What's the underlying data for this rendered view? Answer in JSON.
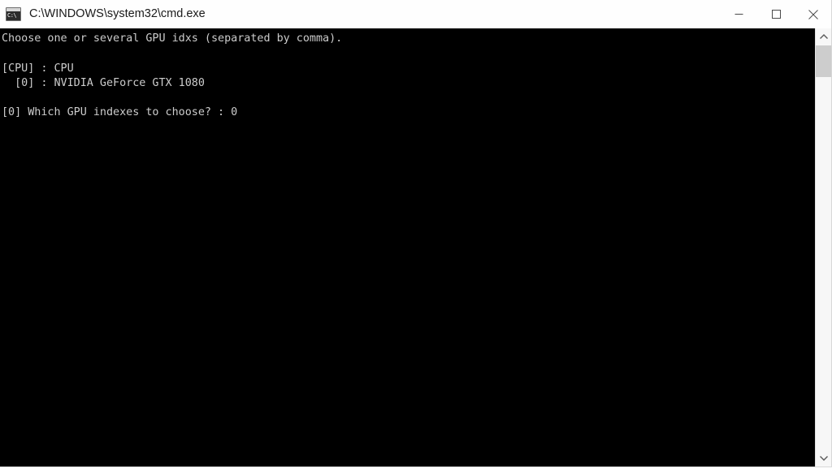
{
  "window": {
    "title": "C:\\WINDOWS\\system32\\cmd.exe",
    "icon_label": "C:\\",
    "icon_name": "cmd-exe-icon",
    "background_color": "#000000",
    "titlebar_color": "#fefefe",
    "text_color": "#cccccc"
  },
  "window_controls": {
    "minimize_label": "Minimize",
    "maximize_label": "Maximize",
    "close_label": "Close"
  },
  "console": {
    "lines": [
      "Choose one or several GPU idxs (separated by comma).",
      "",
      "[CPU] : CPU",
      "  [0] : NVIDIA GeForce GTX 1080",
      "",
      "[0] Which GPU indexes to choose? : 0"
    ],
    "body": "Choose one or several GPU idxs (separated by comma).\n\n[CPU] : CPU\n  [0] : NVIDIA GeForce GTX 1080\n\n[0] Which GPU indexes to choose? : 0",
    "prompt_text": "[0] Which GPU indexes to choose? : ",
    "user_input": "0",
    "devices": [
      {
        "index": "[CPU]",
        "name": "CPU"
      },
      {
        "index": "[0]",
        "name": "NVIDIA GeForce GTX 1080"
      }
    ]
  },
  "scrollbar": {
    "up_label": "Scroll up",
    "down_label": "Scroll down",
    "thumb_label": "Scroll thumb"
  }
}
